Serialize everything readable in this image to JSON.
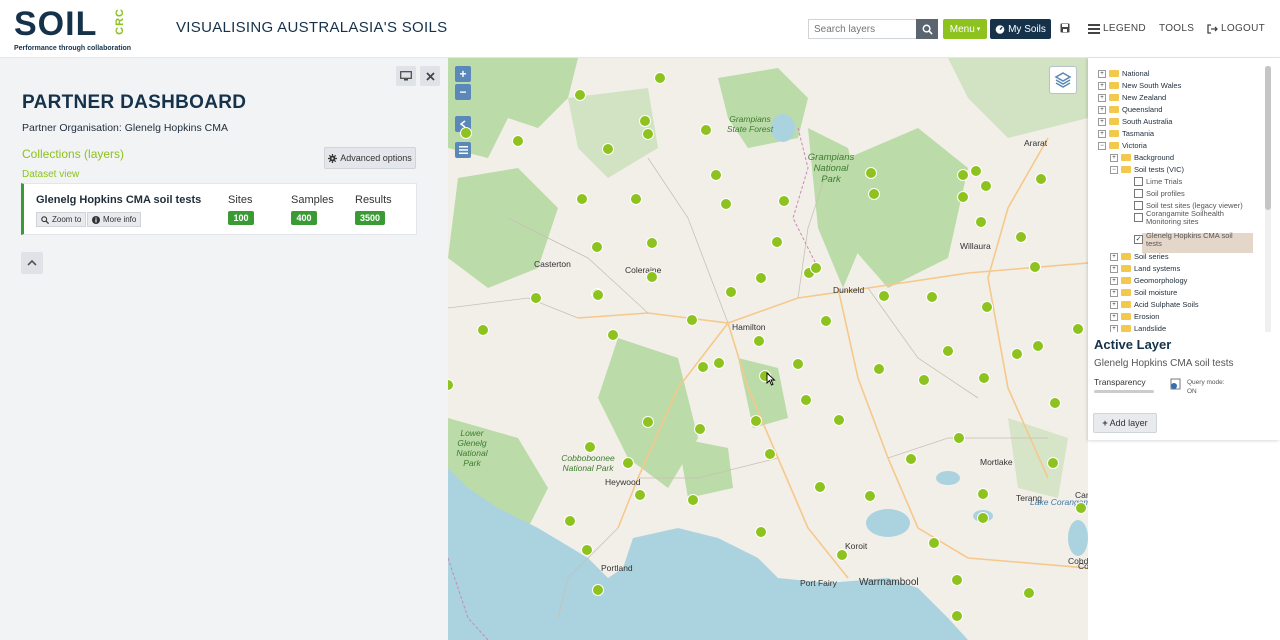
{
  "header": {
    "logo_word": "SOIL",
    "logo_crc": "CRC",
    "logo_tagline": "Performance through collaboration",
    "site_title": "VISUALISING AUSTRALASIA'S SOILS",
    "search_placeholder": "Search layers",
    "menu_label": "Menu",
    "my_soils_label": "My Soils",
    "legend_label": "LEGEND",
    "tools_label": "TOOLS",
    "logout_label": "LOGOUT"
  },
  "dashboard": {
    "title": "PARTNER DASHBOARD",
    "partner_org": "Partner Organisation: Glenelg Hopkins CMA",
    "collections_label": "Collections (layers)",
    "advanced_options_label": "Advanced options",
    "dataset_view_label": "Dataset view",
    "dataset": {
      "name": "Glenelg Hopkins CMA soil tests",
      "zoom_label": "Zoom to",
      "more_info_label": "More info",
      "sites_label": "Sites",
      "sites_value": "100",
      "samples_label": "Samples",
      "samples_value": "400",
      "results_label": "Results",
      "results_value": "3500"
    }
  },
  "map": {
    "places": [
      {
        "name": "Ararat"
      },
      {
        "name": "Willaura"
      },
      {
        "name": "Casterton"
      },
      {
        "name": "Coleraine"
      },
      {
        "name": "Dunkeld"
      },
      {
        "name": "Hamilton"
      },
      {
        "name": "Heywood"
      },
      {
        "name": "Mortlake"
      },
      {
        "name": "Terang"
      },
      {
        "name": "Camperdown"
      },
      {
        "name": "Cobden"
      },
      {
        "name": "Colac"
      },
      {
        "name": "Koroit"
      },
      {
        "name": "Portland"
      },
      {
        "name": "Port Fairy"
      },
      {
        "name": "Warrnambool"
      }
    ],
    "parks": [
      {
        "name": "Grampians State Forest"
      },
      {
        "name": "Grampians National Park"
      },
      {
        "name": "Cobboboonee National Park"
      },
      {
        "name": "Lower Glenelg National Park"
      },
      {
        "name": "Lake Corangamite"
      }
    ]
  },
  "tree": {
    "items": [
      {
        "label": "National",
        "level": 0,
        "type": "folder",
        "expander": "+"
      },
      {
        "label": "New South Wales",
        "level": 0,
        "type": "folder",
        "expander": "+"
      },
      {
        "label": "New Zealand",
        "level": 0,
        "type": "folder",
        "expander": "+"
      },
      {
        "label": "Queensland",
        "level": 0,
        "type": "folder",
        "expander": "+"
      },
      {
        "label": "South Australia",
        "level": 0,
        "type": "folder",
        "expander": "+"
      },
      {
        "label": "Tasmania",
        "level": 0,
        "type": "folder",
        "expander": "+"
      },
      {
        "label": "Victoria",
        "level": 0,
        "type": "folder",
        "expander": "−"
      },
      {
        "label": "Background",
        "level": 1,
        "type": "folder",
        "expander": "+"
      },
      {
        "label": "Soil tests (VIC)",
        "level": 1,
        "type": "folder",
        "expander": "−"
      },
      {
        "label": "Lime Trials",
        "level": 2,
        "type": "check",
        "checked": false
      },
      {
        "label": "Soil profiles",
        "level": 2,
        "type": "check",
        "checked": false
      },
      {
        "label": "Soil test sites (legacy viewer)",
        "level": 2,
        "type": "check",
        "checked": false
      },
      {
        "label": "Corangamite Soilhealth Monitoring sites",
        "level": 2,
        "type": "check",
        "checked": false
      },
      {
        "label": "Glenelg Hopkins CMA soil tests",
        "level": 2,
        "type": "check",
        "checked": true
      },
      {
        "label": "Soil series",
        "level": 1,
        "type": "folder",
        "expander": "+"
      },
      {
        "label": "Land systems",
        "level": 1,
        "type": "folder",
        "expander": "+"
      },
      {
        "label": "Geomorphology",
        "level": 1,
        "type": "folder",
        "expander": "+"
      },
      {
        "label": "Soil moisture",
        "level": 1,
        "type": "folder",
        "expander": "+"
      },
      {
        "label": "Acid Sulphate Soils",
        "level": 1,
        "type": "folder",
        "expander": "+"
      },
      {
        "label": "Erosion",
        "level": 1,
        "type": "folder",
        "expander": "+"
      },
      {
        "label": "Landslide",
        "level": 1,
        "type": "folder",
        "expander": "+"
      }
    ]
  },
  "active_layer": {
    "title": "Active Layer",
    "name": "Glenelg Hopkins CMA soil tests",
    "transparency_label": "Transparency",
    "query_mode": "Query mode: ON",
    "add_layer_label": "Add layer"
  },
  "colors": {
    "brand_navy": "#16324a",
    "brand_green": "#8dc21f",
    "badge_green": "#3a9b35",
    "water": "#aad3df"
  }
}
